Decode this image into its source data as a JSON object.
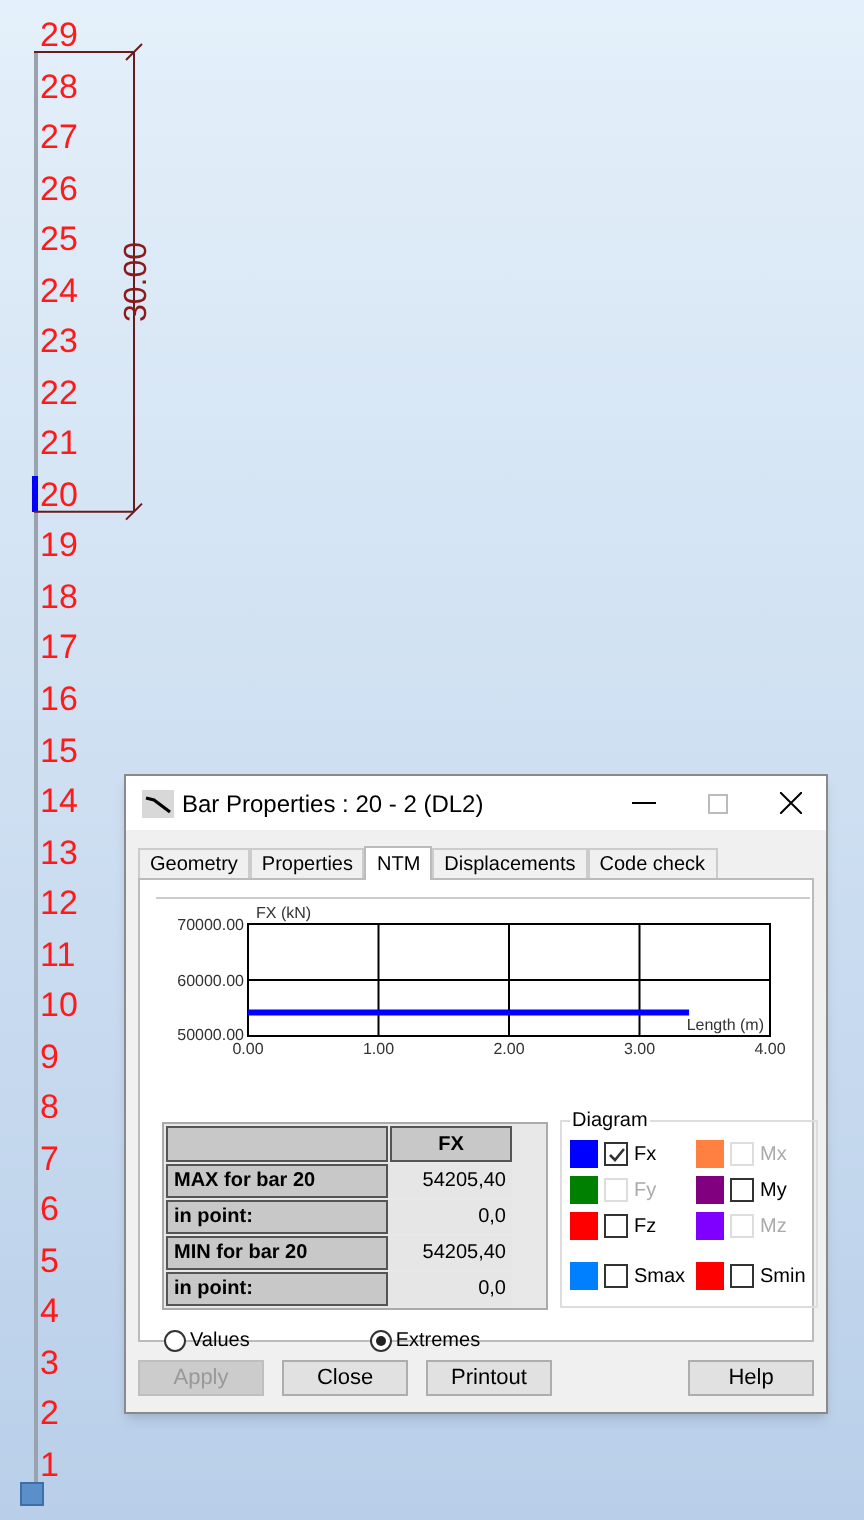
{
  "model": {
    "nodes": [
      {
        "label": "29",
        "selected": false
      },
      {
        "label": "28",
        "selected": false
      },
      {
        "label": "27",
        "selected": false
      },
      {
        "label": "26",
        "selected": false
      },
      {
        "label": "25",
        "selected": false
      },
      {
        "label": "24",
        "selected": false
      },
      {
        "label": "23",
        "selected": false
      },
      {
        "label": "22",
        "selected": false
      },
      {
        "label": "21",
        "selected": false
      },
      {
        "label": "20",
        "selected": true
      },
      {
        "label": "19",
        "selected": false
      },
      {
        "label": "18",
        "selected": false
      },
      {
        "label": "17",
        "selected": false
      },
      {
        "label": "16",
        "selected": false
      },
      {
        "label": "15",
        "selected": false
      },
      {
        "label": "14",
        "selected": false
      },
      {
        "label": "13",
        "selected": false
      },
      {
        "label": "12",
        "selected": false
      },
      {
        "label": "11",
        "selected": false
      },
      {
        "label": "10",
        "selected": false
      },
      {
        "label": "9",
        "selected": false
      },
      {
        "label": "8",
        "selected": false
      },
      {
        "label": "7",
        "selected": false
      },
      {
        "label": "6",
        "selected": false
      },
      {
        "label": "5",
        "selected": false
      },
      {
        "label": "4",
        "selected": false
      },
      {
        "label": "3",
        "selected": false
      },
      {
        "label": "2",
        "selected": false
      },
      {
        "label": "1",
        "selected": false
      }
    ],
    "dimension": "30.00"
  },
  "dialog": {
    "title": "Bar Properties : 20 - 2 (DL2)",
    "tabs": [
      {
        "label": "Geometry",
        "selected": false
      },
      {
        "label": "Properties",
        "selected": false
      },
      {
        "label": "NTM",
        "selected": true
      },
      {
        "label": "Displacements",
        "selected": false
      },
      {
        "label": "Code check",
        "selected": false
      }
    ],
    "chart_data": {
      "type": "line",
      "xlabel": "Length (m)",
      "ylabel": "FX (kN)",
      "x": [
        0,
        3.38
      ],
      "series": [
        {
          "color": "#0000ff",
          "values": [
            54200,
            54200
          ]
        }
      ],
      "grid": true,
      "xlim": [
        0,
        4
      ],
      "ylim": [
        50000,
        70000
      ],
      "xticks": [
        {
          "value": 0,
          "label": "0.00"
        },
        {
          "value": 1,
          "label": "1.00"
        },
        {
          "value": 2,
          "label": "2.00"
        },
        {
          "value": 3,
          "label": "3.00"
        },
        {
          "value": 4,
          "label": "4.00"
        }
      ],
      "yticks": [
        {
          "value": 50000,
          "label": "50000.00"
        },
        {
          "value": 60000,
          "label": "60000.00"
        },
        {
          "value": 70000,
          "label": "70000.00"
        }
      ]
    },
    "table": {
      "columns": [
        "FX"
      ],
      "rows": [
        {
          "label": "MAX for bar 20",
          "value": "54205,40"
        },
        {
          "label": "in point:",
          "value": "0,0"
        },
        {
          "label": "MIN for bar 20",
          "value": "54205,40"
        },
        {
          "label": "in point:",
          "value": "0,0"
        }
      ]
    },
    "diagram": {
      "title": "Diagram",
      "items": [
        {
          "label": "Fx",
          "color": "#0000ff",
          "checked": true,
          "disabled": false
        },
        {
          "label": "Mx",
          "color": "#ff8040",
          "checked": false,
          "disabled": true
        },
        {
          "label": "Fy",
          "color": "#008000",
          "checked": false,
          "disabled": true
        },
        {
          "label": "My",
          "color": "#800080",
          "checked": false,
          "disabled": false
        },
        {
          "label": "Fz",
          "color": "#ff0000",
          "checked": false,
          "disabled": false
        },
        {
          "label": "Mz",
          "color": "#8000ff",
          "checked": false,
          "disabled": true
        },
        {
          "label": "Smax",
          "color": "#0080ff",
          "checked": false,
          "disabled": false
        },
        {
          "label": "Smin",
          "color": "#ff0000",
          "checked": false,
          "disabled": false
        }
      ]
    },
    "radios": [
      {
        "label": "Values",
        "selected": false
      },
      {
        "label": "Extremes",
        "selected": true
      }
    ],
    "buttons": [
      {
        "label": "Apply",
        "disabled": true
      },
      {
        "label": "Close",
        "disabled": false
      },
      {
        "label": "Printout",
        "disabled": false
      },
      {
        "label": "Help",
        "disabled": false
      }
    ]
  }
}
